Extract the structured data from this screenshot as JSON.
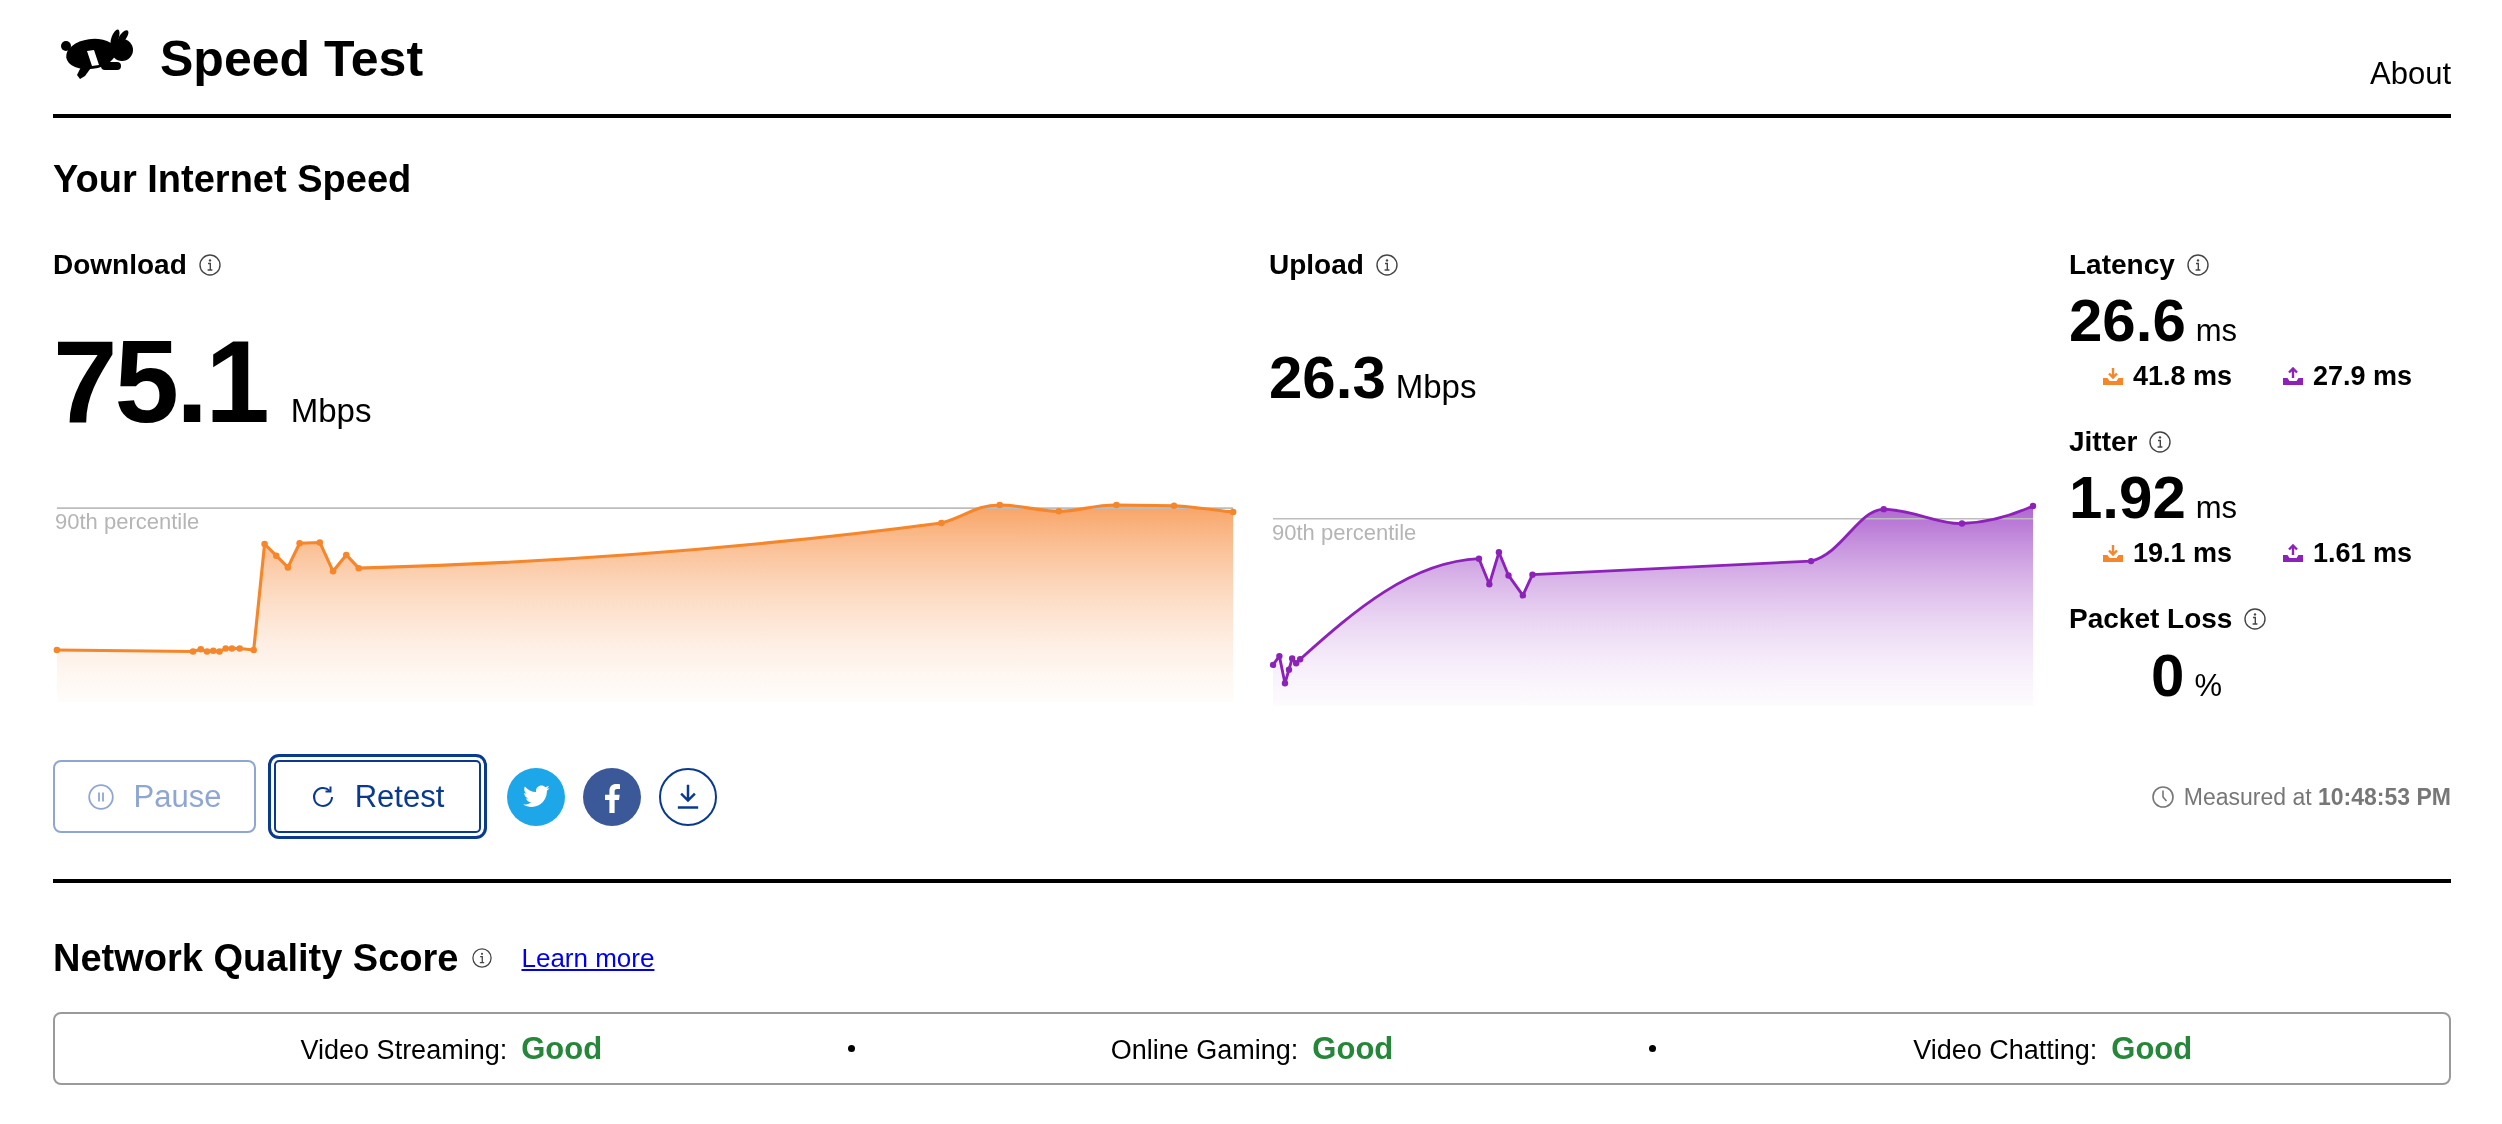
{
  "header": {
    "title": "Speed Test",
    "nav_link": "About"
  },
  "speed": {
    "title": "Your Internet Speed",
    "download": {
      "label": "Download",
      "value": "75.1",
      "unit": "Mbps",
      "percentile_label": "90th percentile"
    },
    "upload": {
      "label": "Upload",
      "value": "26.3",
      "unit": "Mbps",
      "percentile_label": "90th percentile"
    },
    "metrics": [
      {
        "label": "Latency",
        "value": "26.6",
        "unit": "ms",
        "download": "41.8 ms",
        "upload": "27.9 ms"
      },
      {
        "label": "Jitter",
        "value": "1.92",
        "unit": "ms",
        "download": "19.1 ms",
        "upload": "1.61 ms"
      },
      {
        "label": "Packet Loss",
        "value": "0",
        "unit": "%"
      }
    ]
  },
  "actions": {
    "buttons": [
      {
        "label": "Pause",
        "kind": "pause",
        "disabled": true,
        "focused": false
      },
      {
        "label": "Retest",
        "kind": "retest",
        "disabled": false,
        "focused": true
      }
    ],
    "measured": "Measured at **10:48:53 PM**"
  },
  "quality": {
    "title": "Network Quality Score",
    "link": "Learn more",
    "items": [
      {
        "label": "Video Streaming:",
        "rating": "Good"
      },
      {
        "label": "Online Gaming:",
        "rating": "Good"
      },
      {
        "label": "Video Chatting:",
        "rating": "Good"
      }
    ]
  }
}
